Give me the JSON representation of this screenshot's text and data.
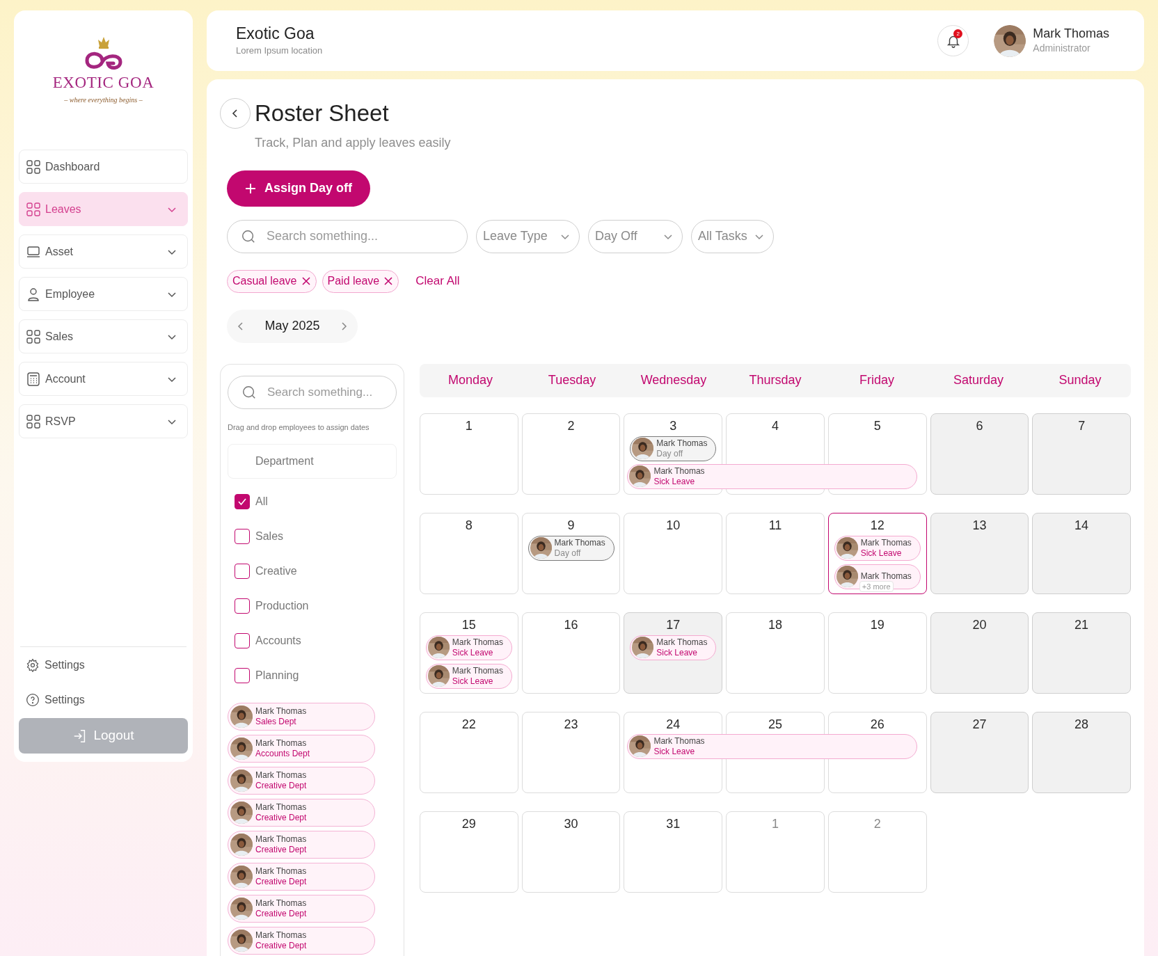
{
  "sidebar": {
    "logo": {
      "name": "EXOTIC GOA",
      "tagline": "– where everything begins –"
    },
    "items": [
      {
        "label": "Dashboard",
        "selected": false,
        "expandable": false
      },
      {
        "label": "Leaves",
        "selected": true,
        "expandable": true
      },
      {
        "label": "Asset",
        "selected": false,
        "expandable": true
      },
      {
        "label": "Employee",
        "selected": false,
        "expandable": true
      },
      {
        "label": "Sales",
        "selected": false,
        "expandable": true
      },
      {
        "label": "Account",
        "selected": false,
        "expandable": true
      },
      {
        "label": "RSVP",
        "selected": false,
        "expandable": true
      }
    ],
    "footer": [
      {
        "label": "Settings"
      },
      {
        "label": "Settings"
      }
    ],
    "logout": "Logout"
  },
  "header": {
    "title": "Exotic Goa",
    "subtitle": "Lorem Ipsum location",
    "notifications": "2",
    "user": {
      "name": "Mark Thomas",
      "role": "Administrator"
    }
  },
  "page": {
    "title": "Roster Sheet",
    "subtitle": "Track, Plan  and apply leaves easily",
    "assign_button": "Assign Day off",
    "search": {
      "placeholder": "Search something..."
    },
    "dropdowns": [
      "Leave Type",
      "Day Off",
      "All Tasks"
    ],
    "chips": [
      "Casual leave",
      "Paid leave"
    ],
    "clear_all": "Clear All",
    "month": "May 2025"
  },
  "employees_panel": {
    "search": {
      "placeholder": "Search something..."
    },
    "hint": "Drag and drop employees to assign dates",
    "department_header": "Department",
    "departments": [
      {
        "label": "All",
        "checked": true
      },
      {
        "label": "Sales",
        "checked": false
      },
      {
        "label": "Creative",
        "checked": false
      },
      {
        "label": "Production",
        "checked": false
      },
      {
        "label": "Accounts",
        "checked": false
      },
      {
        "label": "Planning",
        "checked": false
      }
    ],
    "employees": [
      {
        "name": "Mark Thomas",
        "dept": "Sales Dept"
      },
      {
        "name": "Mark Thomas",
        "dept": "Accounts Dept"
      },
      {
        "name": "Mark Thomas",
        "dept": "Creative Dept"
      },
      {
        "name": "Mark Thomas",
        "dept": "Creative Dept"
      },
      {
        "name": "Mark Thomas",
        "dept": "Creative Dept"
      },
      {
        "name": "Mark Thomas",
        "dept": "Creative Dept"
      },
      {
        "name": "Mark Thomas",
        "dept": "Creative Dept"
      },
      {
        "name": "Mark Thomas",
        "dept": "Creative Dept"
      }
    ]
  },
  "calendar": {
    "weekdays": [
      "Monday",
      "Tuesday",
      "Wednesday",
      "Thursday",
      "Friday",
      "Saturday",
      "Sunday"
    ],
    "weeks": [
      [
        {
          "day": "1"
        },
        {
          "day": "2"
        },
        {
          "day": "3",
          "events": [
            {
              "name": "Mark Thomas",
              "type": "Day off",
              "kind": "day_off",
              "multi_day": false
            },
            {
              "name": "Mark Thomas",
              "type": "Sick Leave",
              "kind": "sick_leave",
              "multi_day": true
            }
          ]
        },
        {
          "day": "4"
        },
        {
          "day": "5"
        },
        {
          "day": "6",
          "shaded": true
        },
        {
          "day": "7",
          "shaded": true
        }
      ],
      [
        {
          "day": "8"
        },
        {
          "day": "9",
          "events": [
            {
              "name": "Mark Thomas",
              "type": "Day off",
              "kind": "day_off",
              "multi_day": false
            }
          ]
        },
        {
          "day": "10"
        },
        {
          "day": "11"
        },
        {
          "day": "12",
          "selected": true,
          "events": [
            {
              "name": "Mark Thomas",
              "type": "Sick Leave",
              "kind": "sick_leave",
              "multi_day": false
            },
            {
              "name": "Mark Thomas",
              "kind": "sick_leave",
              "multi_day": false
            }
          ],
          "more": "+3 more"
        },
        {
          "day": "13",
          "shaded": true
        },
        {
          "day": "14",
          "shaded": true
        }
      ],
      [
        {
          "day": "15",
          "events": [
            {
              "name": "Mark Thomas",
              "type": "Sick Leave",
              "kind": "sick_leave",
              "multi_day": false
            },
            {
              "name": "Mark Thomas",
              "type": "Sick Leave",
              "kind": "sick_leave",
              "multi_day": false
            }
          ]
        },
        {
          "day": "16"
        },
        {
          "day": "17",
          "shaded": true,
          "events": [
            {
              "name": "Mark Thomas",
              "type": "Sick Leave",
              "kind": "sick_leave",
              "multi_day": false
            }
          ]
        },
        {
          "day": "18"
        },
        {
          "day": "19"
        },
        {
          "day": "20",
          "shaded": true
        },
        {
          "day": "21",
          "shaded": true
        }
      ],
      [
        {
          "day": "22"
        },
        {
          "day": "23"
        },
        {
          "day": "24",
          "events": [
            {
              "name": "Mark Thomas",
              "type": "Sick Leave",
              "kind": "sick_leave",
              "multi_day": true
            }
          ]
        },
        {
          "day": "25"
        },
        {
          "day": "26"
        },
        {
          "day": "27",
          "shaded": true
        },
        {
          "day": "28",
          "shaded": true
        }
      ],
      [
        {
          "day": "29"
        },
        {
          "day": "30"
        },
        {
          "day": "31"
        },
        {
          "day": "1",
          "other_month": true
        },
        {
          "day": "2",
          "other_month": true
        }
      ]
    ]
  }
}
